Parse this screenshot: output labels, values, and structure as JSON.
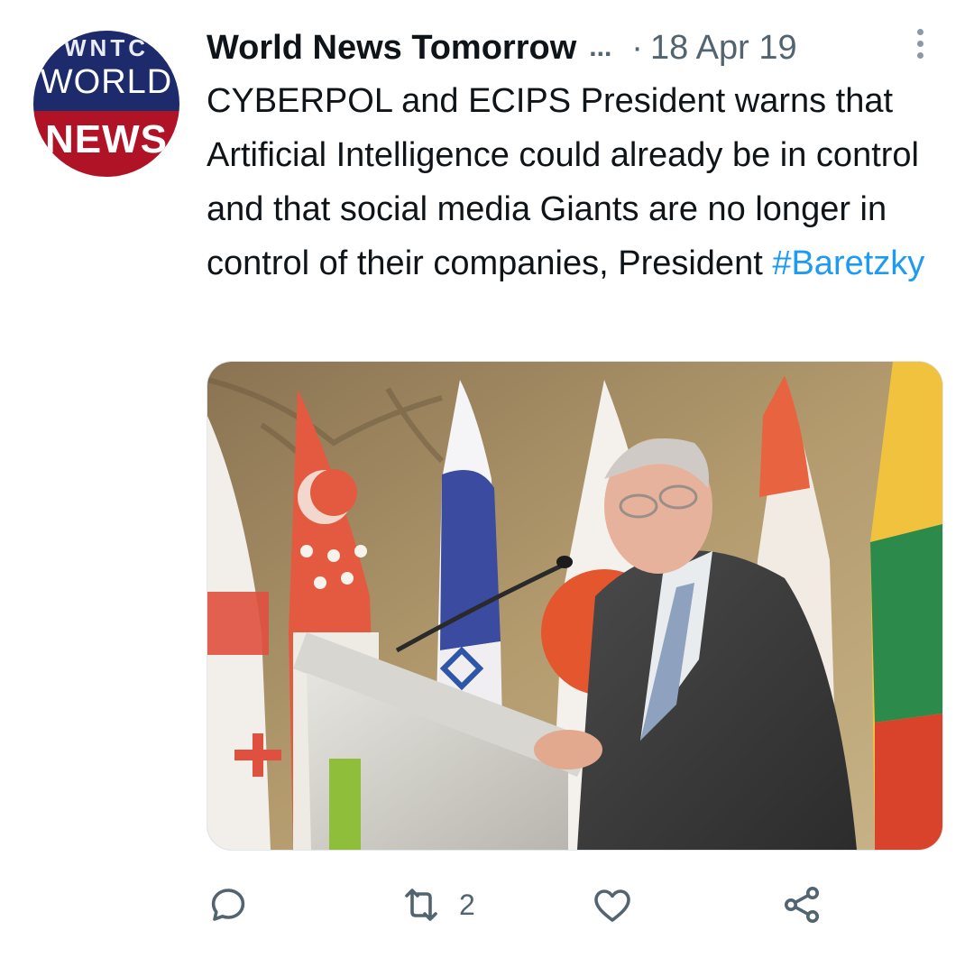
{
  "tweet": {
    "avatar": {
      "top_text": "WNTC",
      "mid_text": "WORLD",
      "bottom_text": "NEWS"
    },
    "author_name": "World News Tomorrow",
    "name_ellipsis": "...",
    "separator": "·",
    "date": "18 Apr 19",
    "text_main": "CYBERPOL and ECIPS President warns that Artificial Intelligence could already be in control and that social media Giants are no longer in control of their companies, President ",
    "hashtag": "#Baretzky",
    "media": {
      "description_icon": "photo",
      "alt": ""
    },
    "actions": {
      "reply_count": "",
      "retweet_count": "2",
      "like_count": ""
    }
  },
  "icons": {
    "reply": "speech-bubble",
    "retweet": "retweet-arrows",
    "like": "heart",
    "share": "share-nodes",
    "more": "vertical-dots"
  },
  "colors": {
    "text": "#0f1419",
    "muted": "#536471",
    "link": "#1d9bf0",
    "avatar_blue": "#1d2a6b",
    "avatar_red": "#b01226"
  }
}
